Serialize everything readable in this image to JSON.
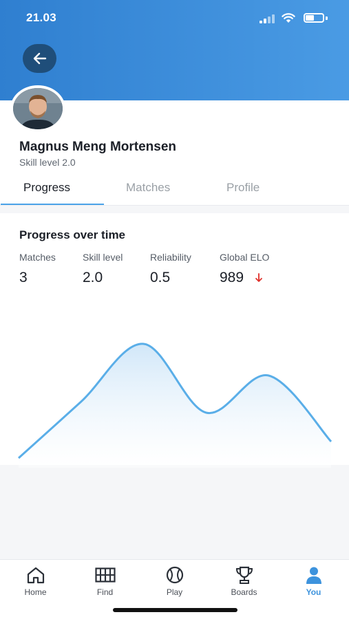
{
  "status_bar": {
    "time": "21.03"
  },
  "profile": {
    "name": "Magnus Meng Mortensen",
    "skill_text": "Skill level 2.0"
  },
  "tabs": [
    {
      "label": "Progress",
      "active": true
    },
    {
      "label": "Matches",
      "active": false
    },
    {
      "label": "Profile",
      "active": false
    }
  ],
  "progress": {
    "title": "Progress over time",
    "stats": [
      {
        "label": "Matches",
        "value": "3"
      },
      {
        "label": "Skill level",
        "value": "2.0"
      },
      {
        "label": "Reliability",
        "value": "0.5"
      },
      {
        "label": "Global ELO",
        "value": "989",
        "trend": "down"
      }
    ]
  },
  "chart_data": {
    "type": "area",
    "x": [
      1,
      2,
      3,
      4,
      5,
      6
    ],
    "y": [
      0.05,
      0.46,
      0.88,
      0.38,
      0.65,
      0.17
    ],
    "color": "#5aaee8"
  },
  "colors": {
    "header_start": "#2f7fd0",
    "header_end": "#4a9be4",
    "accent": "#4aa3e8",
    "trend_down": "#e0302a"
  },
  "tab_bar": [
    {
      "label": "Home",
      "icon": "home-icon",
      "active": false
    },
    {
      "label": "Find",
      "icon": "court-icon",
      "active": false
    },
    {
      "label": "Play",
      "icon": "ball-icon",
      "active": false
    },
    {
      "label": "Boards",
      "icon": "trophy-icon",
      "active": false
    },
    {
      "label": "You",
      "icon": "user-icon",
      "active": true
    }
  ]
}
